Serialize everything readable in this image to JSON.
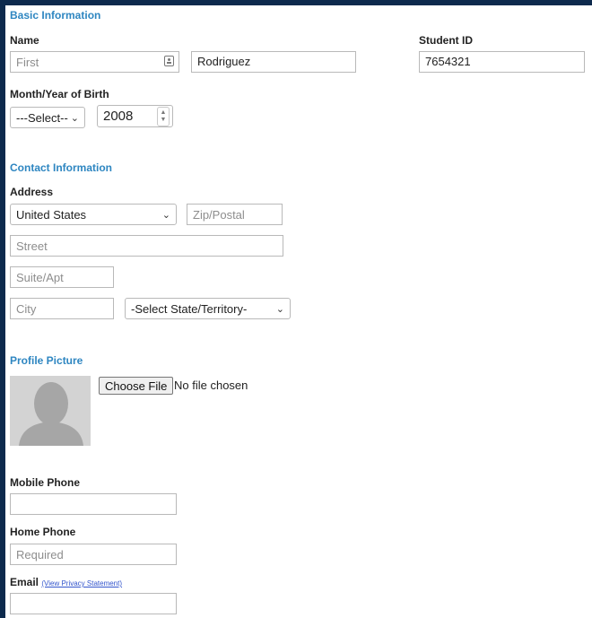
{
  "basic": {
    "title": "Basic Information",
    "name_label": "Name",
    "first_placeholder": "First",
    "last_value": "Rodriguez",
    "student_id_label": "Student ID",
    "student_id_value": "7654321",
    "dob_label": "Month/Year of Birth",
    "month_selected": "---Select--",
    "year_value": "2008"
  },
  "contact": {
    "title": "Contact Information",
    "address_label": "Address",
    "country_selected": "United States",
    "zip_placeholder": "Zip/Postal",
    "street_placeholder": "Street",
    "suite_placeholder": "Suite/Apt",
    "city_placeholder": "City",
    "state_selected": "-Select State/Territory-"
  },
  "profile": {
    "title": "Profile Picture",
    "choose_file_label": "Choose File",
    "no_file_text": "No file chosen"
  },
  "phones": {
    "mobile_label": "Mobile Phone",
    "mobile_value": "",
    "home_label": "Home Phone",
    "home_placeholder": "Required",
    "email_label": "Email",
    "privacy_link": "(View Privacy Statement)",
    "email_value": ""
  },
  "colors": {
    "section_title": "#2e86c1",
    "frame": "#0d2a4d"
  }
}
